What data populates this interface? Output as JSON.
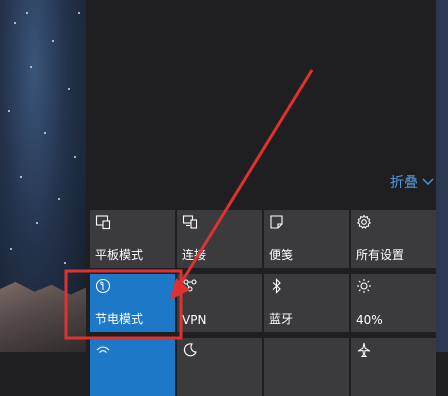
{
  "action_center": {
    "collapse_label": "折叠",
    "tiles": [
      {
        "label": "平板模式",
        "icon": "tablet-mode-icon"
      },
      {
        "label": "连接",
        "icon": "connect-icon"
      },
      {
        "label": "便笺",
        "icon": "note-icon"
      },
      {
        "label": "所有设置",
        "icon": "gear-icon"
      },
      {
        "label": "节电模式",
        "icon": "battery-saver-icon"
      },
      {
        "label": "VPN",
        "icon": "vpn-icon"
      },
      {
        "label": "蓝牙",
        "icon": "bluetooth-icon"
      },
      {
        "label": "40%",
        "icon": "brightness-icon"
      },
      {
        "label": "",
        "icon": "wifi-icon"
      },
      {
        "label": "",
        "icon": "moon-icon"
      },
      {
        "label": "",
        "icon": "blank-icon"
      },
      {
        "label": "",
        "icon": "airplane-icon"
      }
    ]
  },
  "colors": {
    "accent": "#1d78c8",
    "link": "#4f9be3",
    "annotation": "#e03131"
  }
}
